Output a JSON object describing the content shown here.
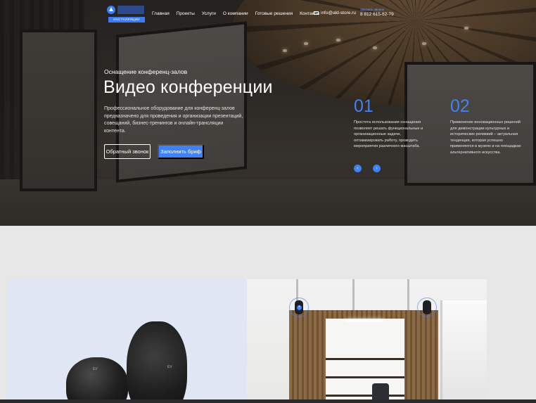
{
  "header": {
    "logo_sub": "ИНСТАЛЛЯЦИИ",
    "nav": [
      "Главная",
      "Проекты",
      "Услуги",
      "О компании",
      "Готовые решения",
      "Контакты"
    ],
    "email": "info@ald-store.ru",
    "phone_label": "Заказать звонок",
    "phone": "8 812 615-62-79"
  },
  "hero": {
    "eyebrow": "Оснащение конференц-залов",
    "title": "Видео конференции",
    "description": "Профессиональное оборудование для конференц-залов предназначено для проведения и организации презентаций, совещаний, бизнес-тренингов и онлайн-трансляции контента.",
    "btn_callback": "Обратный звонок",
    "btn_brief": "Заполнить бриф",
    "features": [
      {
        "num": "01",
        "text": "Простота использования оснащения позволяет решать функциональные и организационные задачи, оптимизировать работу, проводить мероприятия различного масштаба."
      },
      {
        "num": "02",
        "text": "Применение инновационных решений для демонстрации культурных и исторических реликвий – актуальная тенденция, которая успешно применяется в музеях и на площадках альтернативного искусства."
      }
    ],
    "prev_arrow": "‹",
    "next_arrow": "›"
  },
  "colors": {
    "accent": "#3f82f7",
    "section_bg": "#e7e7e7"
  }
}
